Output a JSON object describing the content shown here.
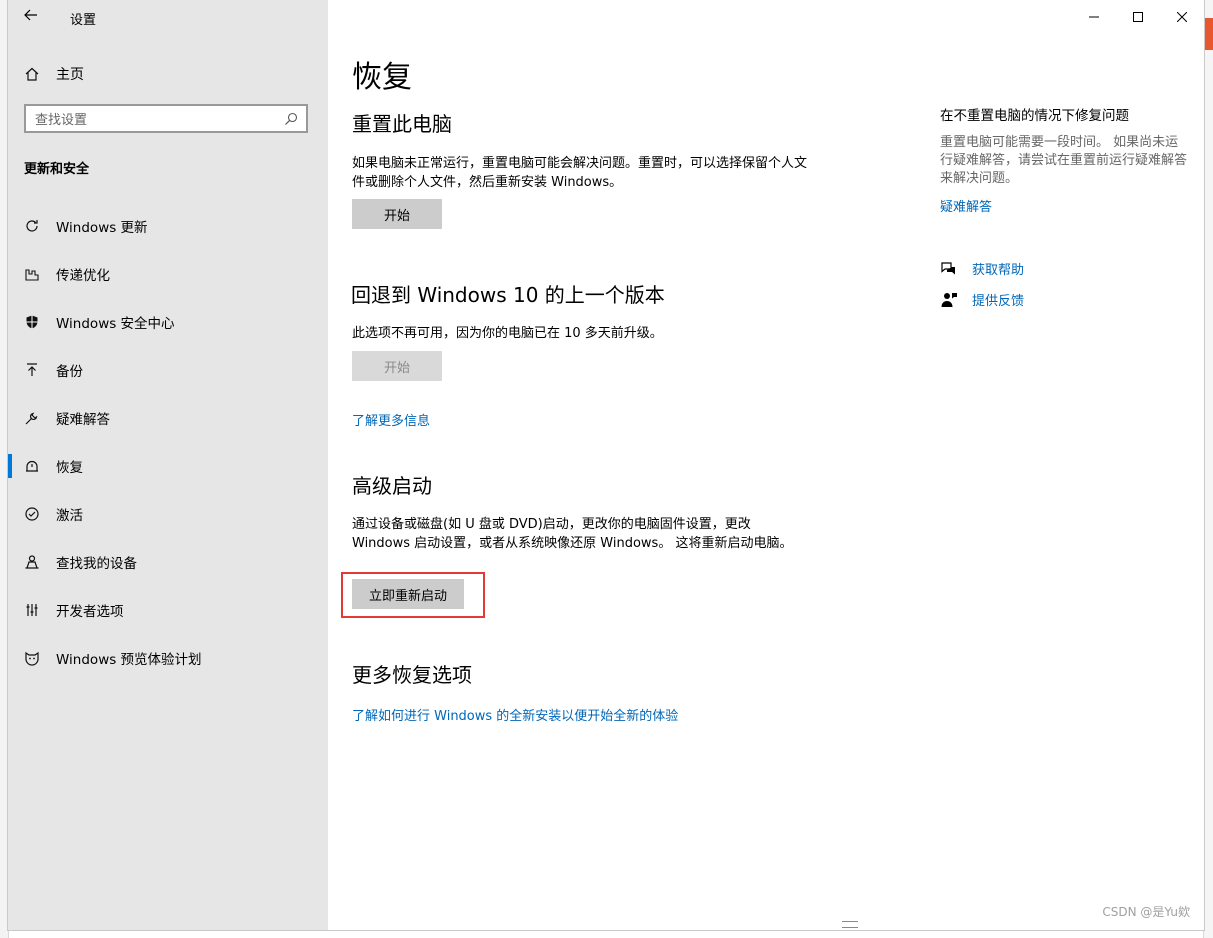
{
  "window": {
    "title": "设置",
    "controls": {
      "minimize": "—",
      "maximize": "☐",
      "close": "✕"
    }
  },
  "sidebar": {
    "home": "主页",
    "search_placeholder": "查找设置",
    "section_title": "更新和安全",
    "items": [
      {
        "label": "Windows 更新",
        "icon": "refresh-icon"
      },
      {
        "label": "传递优化",
        "icon": "delivery-icon"
      },
      {
        "label": "Windows 安全中心",
        "icon": "shield-icon"
      },
      {
        "label": "备份",
        "icon": "backup-arrow-icon"
      },
      {
        "label": "疑难解答",
        "icon": "wrench-icon"
      },
      {
        "label": "恢复",
        "icon": "recovery-icon",
        "active": true
      },
      {
        "label": "激活",
        "icon": "check-circle-icon"
      },
      {
        "label": "查找我的设备",
        "icon": "person-pin-icon"
      },
      {
        "label": "开发者选项",
        "icon": "developer-tools-icon"
      },
      {
        "label": "Windows 预览体验计划",
        "icon": "insider-cat-icon"
      }
    ]
  },
  "main": {
    "page_title": "恢复",
    "reset": {
      "heading": "重置此电脑",
      "description": "如果电脑未正常运行，重置电脑可能会解决问题。重置时，可以选择保留个人文件或删除个人文件，然后重新安装 Windows。",
      "button": "开始"
    },
    "rollback": {
      "heading": "回退到 Windows 10 的上一个版本",
      "description": "此选项不再可用，因为你的电脑已在 10 多天前升级。",
      "button": "开始",
      "link": "了解更多信息"
    },
    "advanced": {
      "heading": "高级启动",
      "description": "通过设备或磁盘(如 U 盘或 DVD)启动，更改你的电脑固件设置，更改 Windows 启动设置，或者从系统映像还原 Windows。 这将重新启动电脑。",
      "button": "立即重新启动"
    },
    "more": {
      "heading": "更多恢复选项",
      "link": "了解如何进行 Windows 的全新安装以便开始全新的体验"
    }
  },
  "right_panel": {
    "title": "在不重置电脑的情况下修复问题",
    "text": "重置电脑可能需要一段时间。 如果尚未运行疑难解答，请尝试在重置前运行疑难解答来解决问题。",
    "link": "疑难解答",
    "help": "获取帮助",
    "feedback": "提供反馈"
  },
  "watermark": "CSDN @是Yu欸",
  "colors": {
    "accent": "#0078d7",
    "link": "#0067b8",
    "highlight_box": "#e53935"
  }
}
